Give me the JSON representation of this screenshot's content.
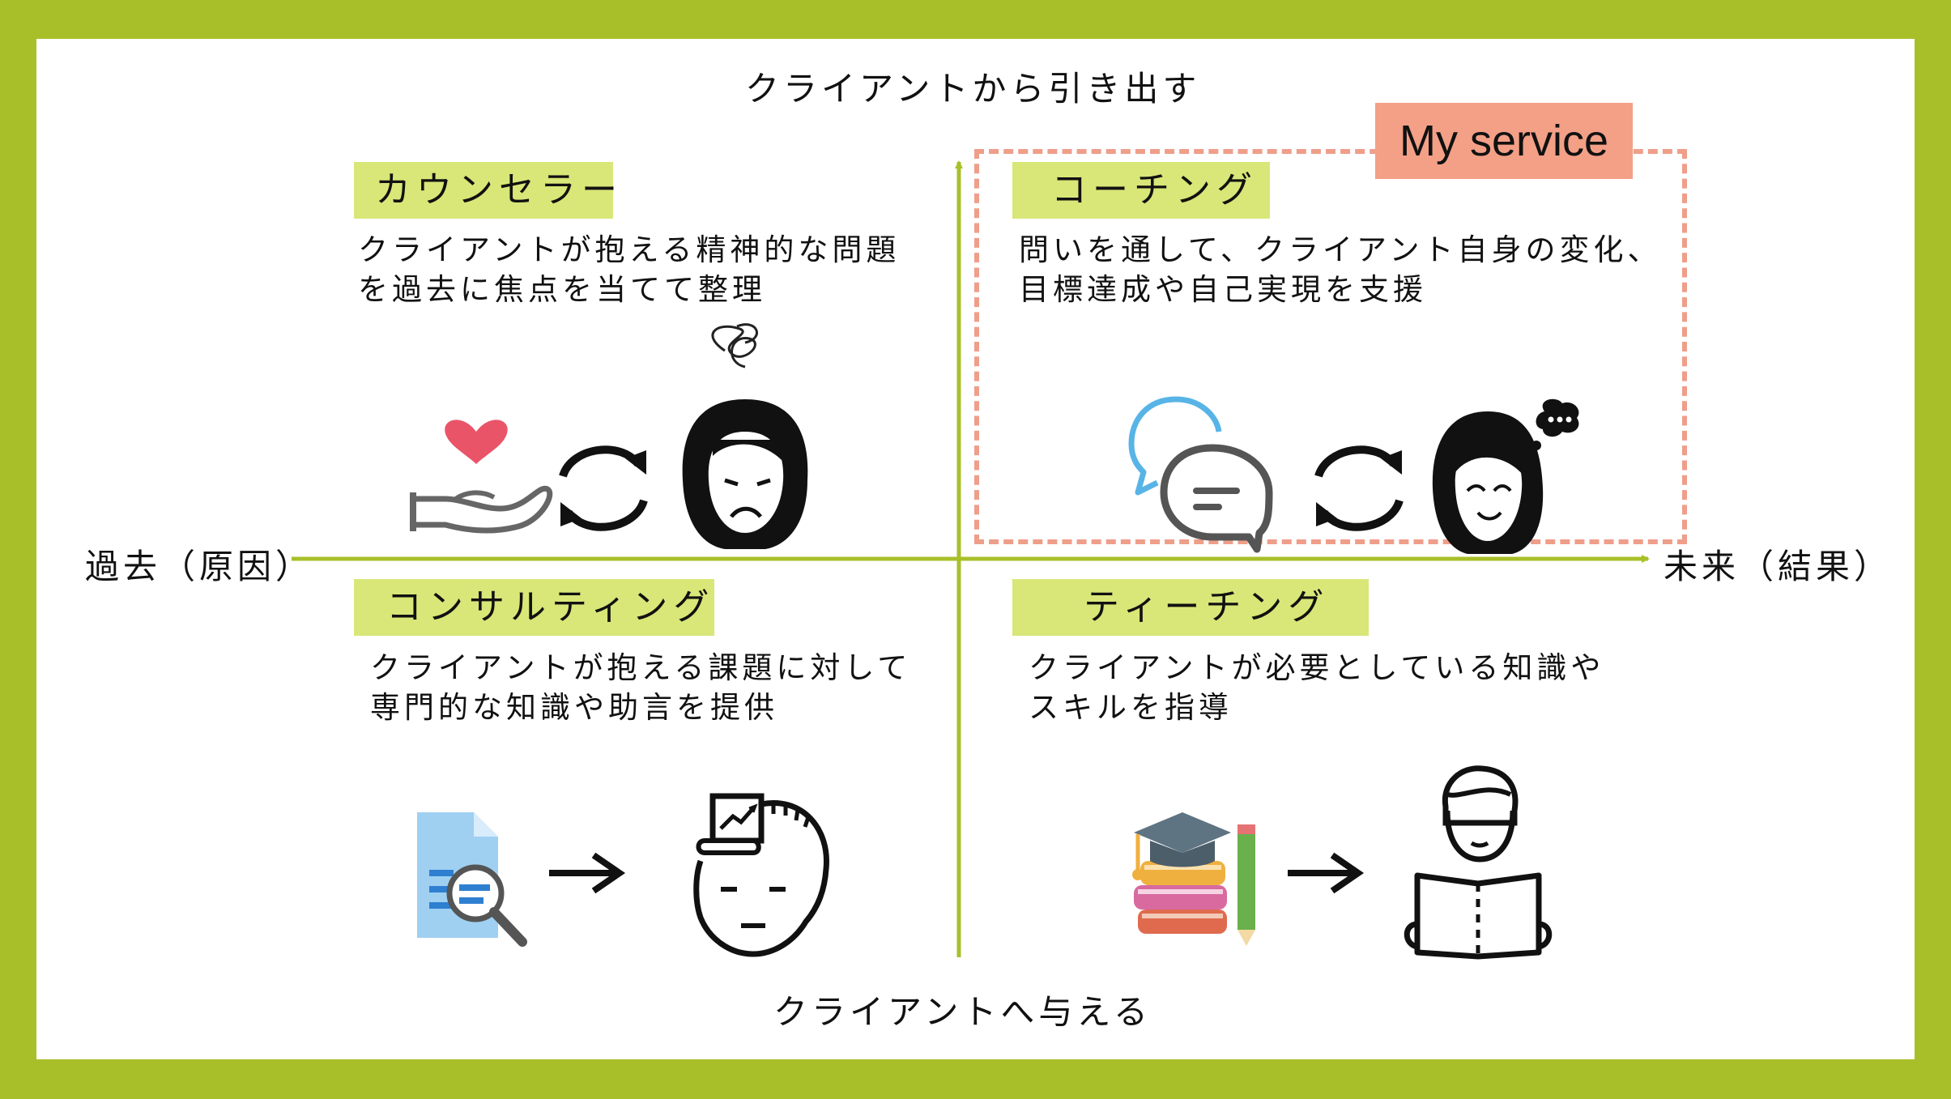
{
  "axes": {
    "top": "クライアントから引き出す",
    "bottom": "クライアントへ与える",
    "left": "過去（原因）",
    "right": "未来（結果）"
  },
  "highlight": {
    "label": "My service"
  },
  "quadrants": {
    "counselor": {
      "title": "カウンセラー",
      "desc_line1": "クライアントが抱える精神的な問題",
      "desc_line2": "を過去に焦点を当てて整理"
    },
    "coaching": {
      "title": "コーチング",
      "desc_line1": "問いを通して、クライアント自身の変化、",
      "desc_line2": "目標達成や自己実現を支援"
    },
    "consulting": {
      "title": "コンサルティング",
      "desc_line1": "クライアントが抱える課題に対して",
      "desc_line2": "専門的な知識や助言を提供"
    },
    "teaching": {
      "title": "ティーチング",
      "desc_line1": "クライアントが必要としている知識や",
      "desc_line2": "スキルを指導"
    }
  },
  "colors": {
    "frame": "#a9bf2a",
    "axis": "#a9bf2a",
    "tag": "#d8e777",
    "highlight": "#f3a087",
    "dash": "#ef9e8a"
  },
  "icons": {
    "counselor": [
      "caring-hand-heart-icon",
      "cycle-arrows-icon",
      "worried-woman-icon"
    ],
    "coaching": [
      "chat-bubbles-icon",
      "cycle-arrows-icon",
      "thinking-happy-woman-icon"
    ],
    "consulting": [
      "document-search-icon",
      "right-arrow-icon",
      "analytical-head-icon"
    ],
    "teaching": [
      "books-graduation-cap-icon",
      "right-arrow-icon",
      "reading-man-icon"
    ]
  }
}
